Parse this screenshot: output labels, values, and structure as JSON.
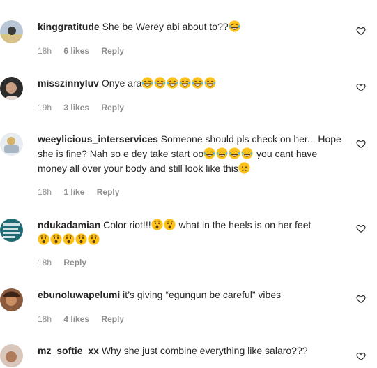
{
  "heart_icon": "heart-outline-icon",
  "comments": [
    {
      "username": "kinggratitude",
      "text": "She be Werey abi about to??",
      "emoji": "laughing-tears-emoji",
      "emoji_count": 1,
      "time": "18h",
      "likes": "6 likes",
      "reply": "Reply"
    },
    {
      "username": "misszinnyluv",
      "text": "Onye ara",
      "emoji": "laughing-tears-emoji",
      "emoji_count": 6,
      "time": "19h",
      "likes": "3 likes",
      "reply": "Reply"
    },
    {
      "username": "weeylicious_interservices",
      "text": "Someone should pls check on her... Hope she is fine? Nah so e dey take start oo",
      "emoji": "laughing-tears-emoji",
      "emoji_count": 4,
      "text_after": "you cant have money all over your body and still look like this",
      "emoji_after": "sad-tear-emoji",
      "time": "18h",
      "likes": "1 like",
      "reply": "Reply"
    },
    {
      "username": "ndukadamian",
      "text": "Color riot!!!",
      "emoji": "astonished-emoji",
      "emoji_count": 2,
      "text_after": "what in the heels is on her feet",
      "emoji_after": "astonished-emoji",
      "emoji_after_count": 5,
      "time": "18h",
      "likes": "",
      "reply": "Reply"
    },
    {
      "username": "ebunoluwapelumi",
      "text": "it’s giving “egungun be careful” vibes",
      "time": "18h",
      "likes": "4 likes",
      "reply": "Reply"
    },
    {
      "username": "mz_softie_xx",
      "text": "Why she just combine everything like salaro???",
      "time": "",
      "likes": "",
      "reply": ""
    }
  ]
}
